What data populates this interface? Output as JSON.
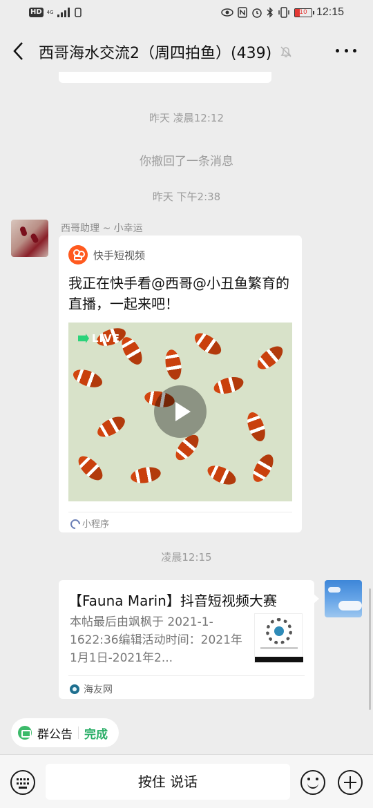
{
  "status_bar": {
    "left_badge": "HD",
    "network_label": "4G",
    "battery_level": "10",
    "time": "12:15",
    "icons": [
      "eye-icon",
      "nfc-icon",
      "alarm-icon",
      "bluetooth-icon",
      "vibrate-icon",
      "battery-icon"
    ]
  },
  "header": {
    "title": "西哥海水交流2（周四拍鱼）(439)",
    "back_icon": "chevron-left-icon",
    "mute_icon": "bell-off-icon",
    "more_icon": "more-dots-icon"
  },
  "messages": {
    "time_1": "昨天 凌晨12:12",
    "recall_notice": "你撤回了一条消息",
    "time_2": "昨天 下午2:38",
    "sender_name": "西哥助理 ~ 小幸运",
    "kuaishou_card": {
      "app_name": "快手短视频",
      "title": "我正在快手看@西哥@小丑鱼繁育的直播，一起来吧！",
      "live_label": "LIVE",
      "footer": "小程序"
    },
    "time_3": "凌晨12:15",
    "link_card": {
      "title": "【Fauna Marin】抖音短视频大赛",
      "description": "本帖最后由飒枫于 2021-1-1622:36编辑活动时间：2021年1月1日-2021年2...",
      "source": "海友网"
    }
  },
  "group_notice": {
    "label": "群公告",
    "action": "完成"
  },
  "input_bar": {
    "hold_to_talk": "按住 说话",
    "icons": [
      "keyboard-icon",
      "emoji-icon",
      "plus-icon"
    ]
  },
  "colors": {
    "background": "#ededed",
    "accent_green": "#2aae67",
    "kuaishou_orange": "#ff5a1f"
  }
}
